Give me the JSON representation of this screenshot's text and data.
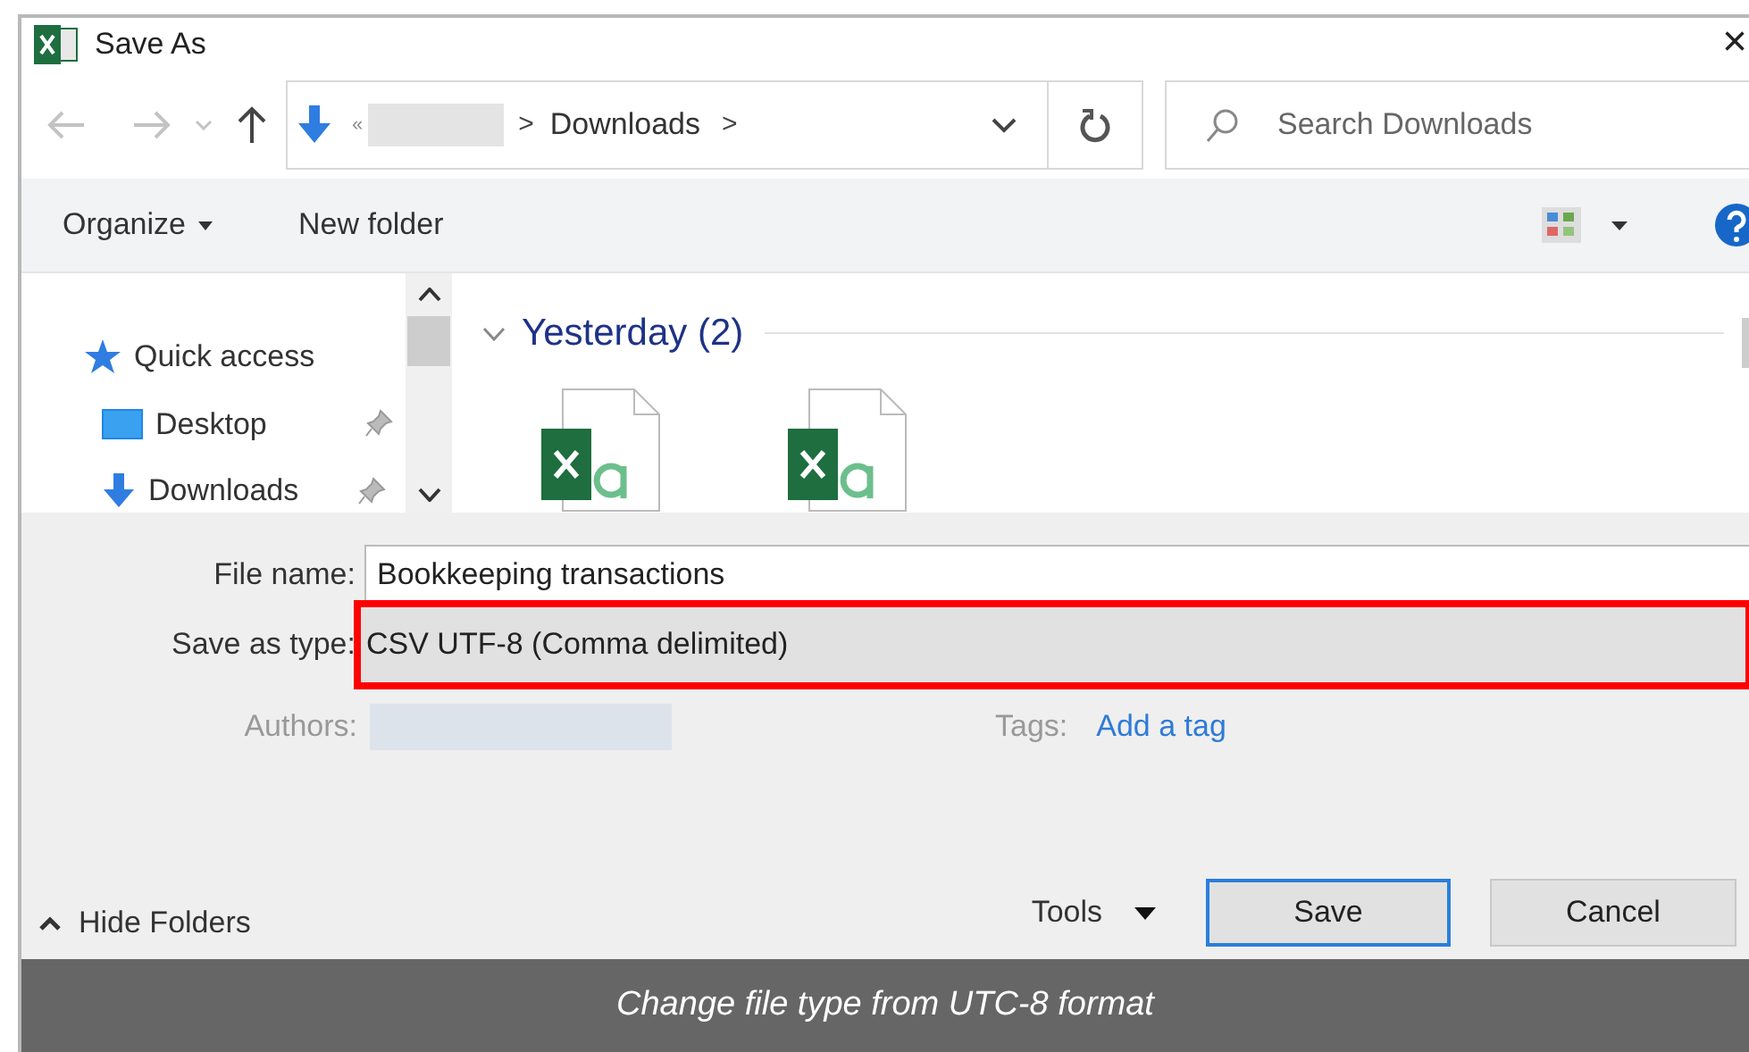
{
  "window": {
    "title": "Save As",
    "close": "×"
  },
  "address": {
    "overflow": "«",
    "separators": [
      ">",
      ">"
    ],
    "folder": "Downloads"
  },
  "search": {
    "placeholder": "Search Downloads"
  },
  "toolbar": {
    "organize": "Organize",
    "new_folder": "New folder"
  },
  "sidebar": {
    "items": [
      {
        "label": "Quick access",
        "kind": "star",
        "pinned": false
      },
      {
        "label": "Desktop",
        "kind": "desktop",
        "pinned": true
      },
      {
        "label": "Downloads",
        "kind": "download",
        "pinned": true
      }
    ]
  },
  "group": {
    "label": "Yesterday (2)",
    "expanded": true,
    "files": [
      {
        "kind": "excel-csv"
      },
      {
        "kind": "excel-csv"
      }
    ]
  },
  "form": {
    "file_name_label": "File name:",
    "file_name": "Bookkeeping transactions",
    "type_label": "Save as type:",
    "type": "CSV UTF-8 (Comma delimited)",
    "type_highlighted": true,
    "authors_label": "Authors:",
    "tags_label": "Tags:",
    "tags_link": "Add a tag"
  },
  "footer": {
    "hide_folders": "Hide Folders",
    "tools": "Tools",
    "save": "Save",
    "cancel": "Cancel"
  },
  "caption": "Change file type from UTC-8 format"
}
